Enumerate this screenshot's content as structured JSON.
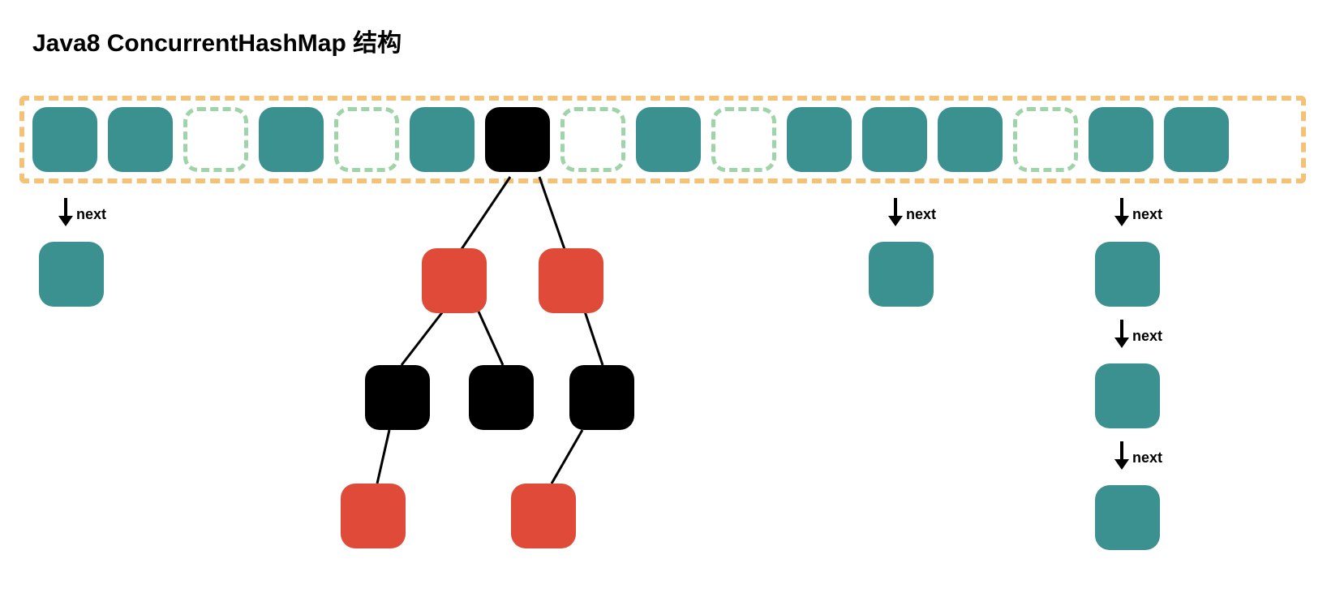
{
  "title": "Java8 ConcurrentHashMap 结构",
  "labels": {
    "next": "next"
  },
  "colors": {
    "teal": "#3b9090",
    "red": "#df4b38",
    "black": "#000000",
    "emptyBorder": "#9fd3a8",
    "tableBorder": "#f4c277"
  },
  "tableBuckets": [
    {
      "type": "filled"
    },
    {
      "type": "filled"
    },
    {
      "type": "empty"
    },
    {
      "type": "filled"
    },
    {
      "type": "empty"
    },
    {
      "type": "filled"
    },
    {
      "type": "root"
    },
    {
      "type": "empty"
    },
    {
      "type": "filled"
    },
    {
      "type": "empty"
    },
    {
      "type": "filled"
    },
    {
      "type": "filled"
    },
    {
      "type": "filled"
    },
    {
      "type": "empty"
    },
    {
      "type": "filled"
    },
    {
      "type": "filled"
    }
  ],
  "linkedLists": [
    {
      "bucketIndex": 0,
      "chainLength": 1
    },
    {
      "bucketIndex": 11,
      "chainLength": 1
    },
    {
      "bucketIndex": 14,
      "chainLength": 3
    }
  ],
  "tree": {
    "rootBucketIndex": 6,
    "structure": "black root -> [red-left -> [black, black], red-right -> [null, black -> [red, null]]] + extra red leaf under left subtree",
    "nodes": [
      {
        "id": "r",
        "color": "black"
      },
      {
        "id": "l1",
        "color": "red"
      },
      {
        "id": "r1",
        "color": "red"
      },
      {
        "id": "l2a",
        "color": "black"
      },
      {
        "id": "l2b",
        "color": "black"
      },
      {
        "id": "r2",
        "color": "black"
      },
      {
        "id": "l3",
        "color": "red"
      },
      {
        "id": "r3",
        "color": "red"
      }
    ]
  }
}
